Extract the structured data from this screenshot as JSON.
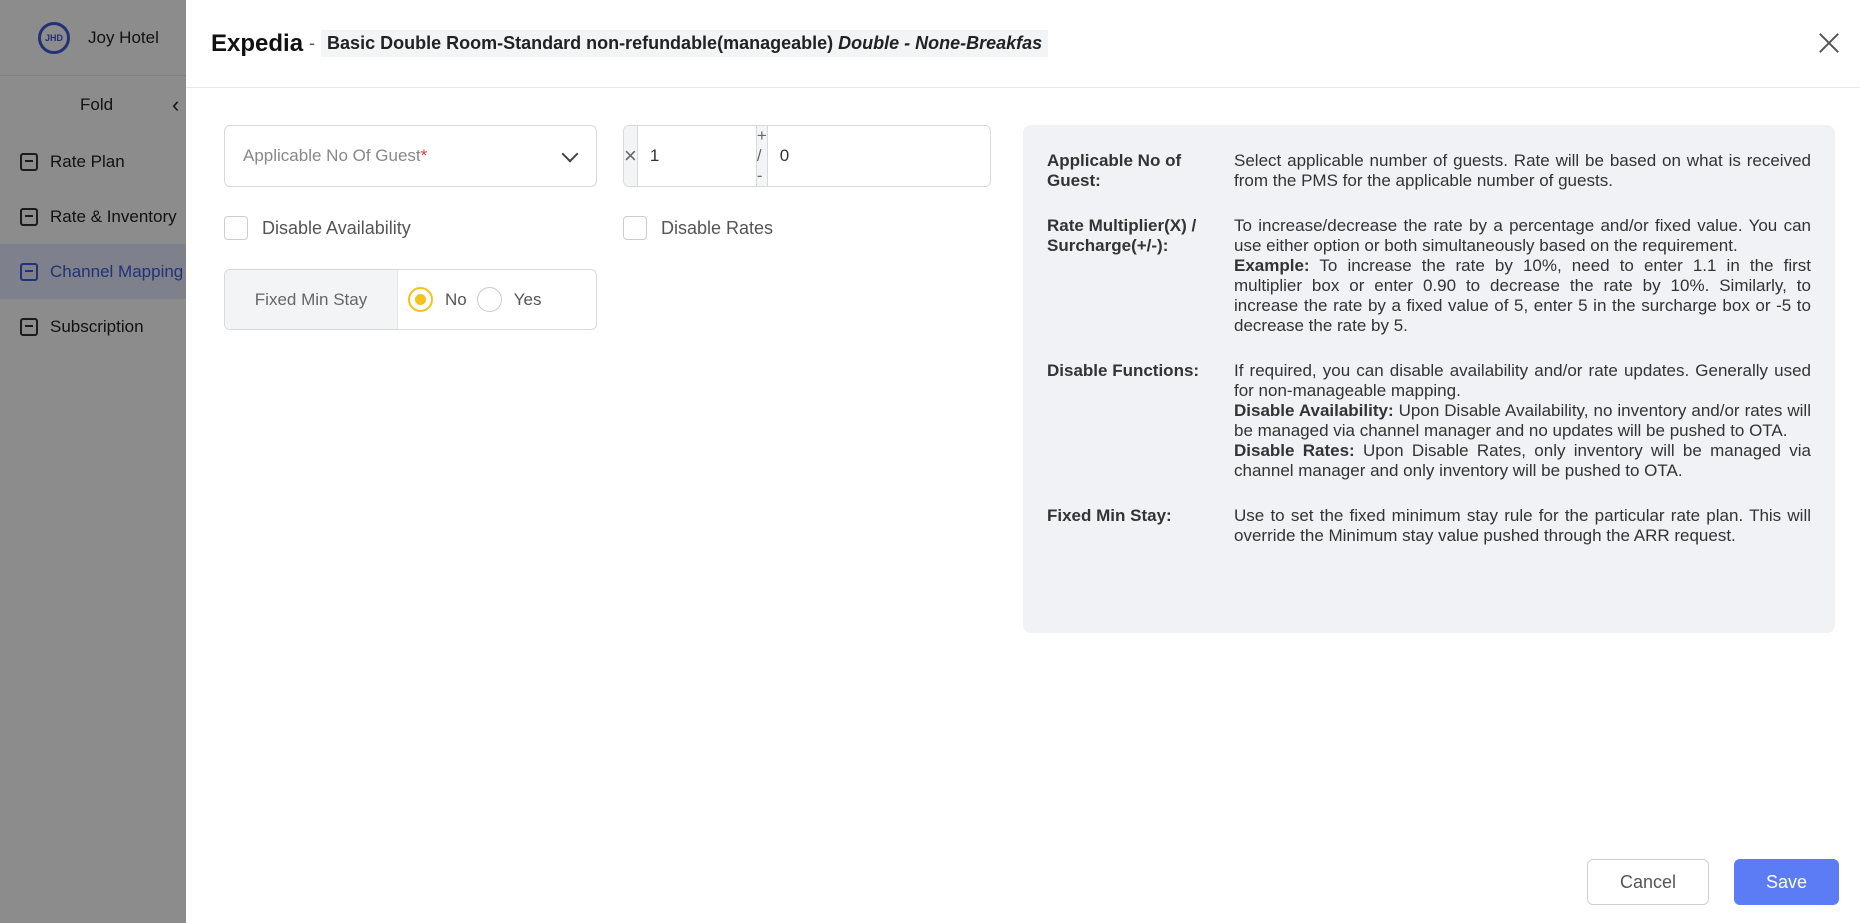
{
  "sidebar": {
    "logo_text": "JHD",
    "hotel_name": "Joy Hotel",
    "fold_label": "Fold",
    "items": [
      {
        "label": "Rate Plan",
        "icon": "rate-plan-icon"
      },
      {
        "label": "Rate & Inventory",
        "icon": "inventory-icon"
      },
      {
        "label": "Channel Mapping",
        "icon": "channel-mapping-icon",
        "active": true
      },
      {
        "label": "Subscription",
        "icon": "subscription-icon"
      }
    ]
  },
  "drawer": {
    "channel": "Expedia",
    "separator": "-",
    "room_name": "Basic Double Room-Standard non-refundable(manageable)",
    "room_detail": "Double - None-Breakfas"
  },
  "form": {
    "guest_select_placeholder": "Applicable No Of Guest",
    "required_mark": "*",
    "multiplier_symbol": "×",
    "multiplier_value": "1",
    "surcharge_symbol": "+ / -",
    "surcharge_value": "0",
    "disable_availability_label": "Disable Availability",
    "disable_rates_label": "Disable Rates",
    "fixed_min_stay_label": "Fixed Min Stay",
    "radio_no": "No",
    "radio_yes": "Yes",
    "fixed_min_stay_selected": "No"
  },
  "help": {
    "guest_key": "Applicable No of Guest:",
    "guest_val": "Select applicable number of guests. Rate will be based on what is received from the PMS for the applicable number of guests.",
    "mult_key": "Rate Multiplier(X) / Surcharge(+/-):",
    "mult_val": "To increase/decrease the rate by a percentage and/or fixed value. You can use either option or both simultaneously based on the requirement.",
    "example_label": "Example:",
    "example_val": "To increase the rate by 10%, need to enter 1.1 in the first multiplier box or enter 0.90 to decrease the rate by 10%. Similarly, to increase the rate by a fixed value of 5, enter 5 in the surcharge box or -5 to decrease the rate by 5.",
    "disable_key": "Disable Functions:",
    "disable_val": "If required, you can disable availability and/or rate updates. Generally used for non-manageable mapping.",
    "da_label": "Disable Availability:",
    "da_val": "Upon Disable Availability, no inventory and/or rates will be managed via channel manager and no updates will be pushed to OTA.",
    "dr_label": "Disable Rates:",
    "dr_val": "Upon Disable Rates, only inventory will be managed via channel manager and only inventory will be pushed to OTA.",
    "fms_key": "Fixed Min Stay:",
    "fms_val": "Use to set the fixed minimum stay rule for the particular rate plan. This will override the Minimum stay value pushed through the ARR request."
  },
  "footer": {
    "cancel_label": "Cancel",
    "save_label": "Save"
  },
  "colors": {
    "primary": "#5b7cf5",
    "radio_selected": "#f4c21a",
    "required": "#e53935"
  }
}
